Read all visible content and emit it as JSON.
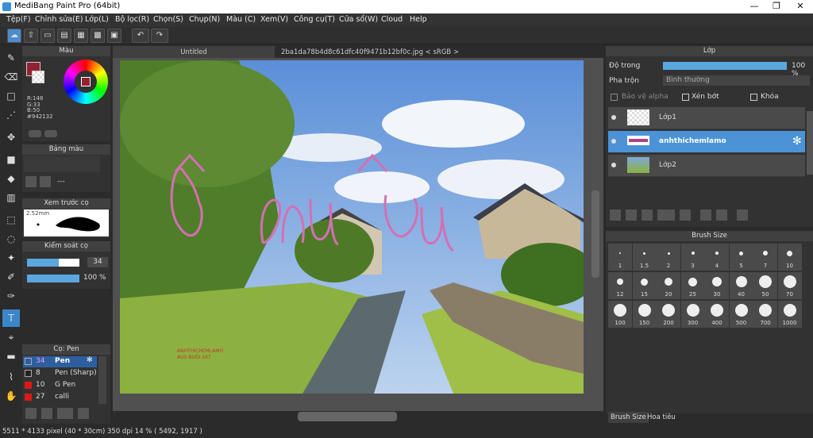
{
  "titlebar": {
    "title": "MediBang Paint Pro (64bit)",
    "min": "—",
    "max": "❐",
    "close": "✕"
  },
  "menu": [
    "Tệp(F)",
    "Chỉnh sửa(E)",
    "Lớp(L)",
    "Bộ lọc(R)",
    "Chọn(S)",
    "Chụp(N)",
    "Màu (C)",
    "Xem(V)",
    "Công cụ(T)",
    "Cửa sổ(W)",
    "Cloud",
    "Help"
  ],
  "color_panel": {
    "title": "Màu",
    "r": "R:148",
    "g": "G:33",
    "b": "B:50",
    "hex": "#942132",
    "fg": "#942132"
  },
  "palette_panel": {
    "title": "Bảng màu",
    "value": "---"
  },
  "preview_panel": {
    "title": "Xem trước cọ",
    "size": "2.52mm"
  },
  "control_panel": {
    "title": "Kiểm soát cọ",
    "size": "34",
    "opacity": "100 %",
    "size_fill": 0.6,
    "opacity_fill": 1.0
  },
  "brush_list": {
    "title": "Cọ: Pen",
    "items": [
      {
        "size": "34",
        "name": "Pen",
        "color": "#1f2b44"
      },
      {
        "size": "8",
        "name": "Pen (Sharp)",
        "color": "#222"
      },
      {
        "size": "10",
        "name": "G Pen",
        "color": "#e01818"
      },
      {
        "size": "27",
        "name": "calli",
        "color": "#e01818"
      }
    ]
  },
  "tabs": {
    "untitled": "Untitled",
    "file": "2ba1da78b4d8c61dfc40f9471b12bf0c.jpg < sRGB >"
  },
  "layer_panel": {
    "title": "Lớp",
    "opacity_label": "Độ trong",
    "opacity_value": "100 %",
    "blend_label": "Pha trộn",
    "blend_value": "Bình thường",
    "protect_alpha": "Bảo vệ alpha",
    "clip": "Xén bớt",
    "lock": "Khóa",
    "layers": [
      "Lớp1",
      "anhthichemlamo",
      "Lớp2"
    ]
  },
  "brush_size_panel": {
    "title": "Brush Size",
    "sizes": [
      "1",
      "1.5",
      "2",
      "3",
      "4",
      "5",
      "7",
      "10",
      "12",
      "15",
      "20",
      "25",
      "30",
      "40",
      "50",
      "70",
      "100",
      "150",
      "200",
      "300",
      "400",
      "500",
      "700",
      "1000"
    ],
    "tab1": "Brush Size",
    "tab2": "Hoa tiêu"
  },
  "canvas": {
    "handwriting": "Ô Mâu",
    "watermark_line1": "ANHTHICHEMLAMO",
    "watermark_line2": "AUS BUỒI 247"
  },
  "status": "5511 * 4133 pixel  (40 * 30cm)  350 dpi   14 %   ( 5492, 1917 )"
}
